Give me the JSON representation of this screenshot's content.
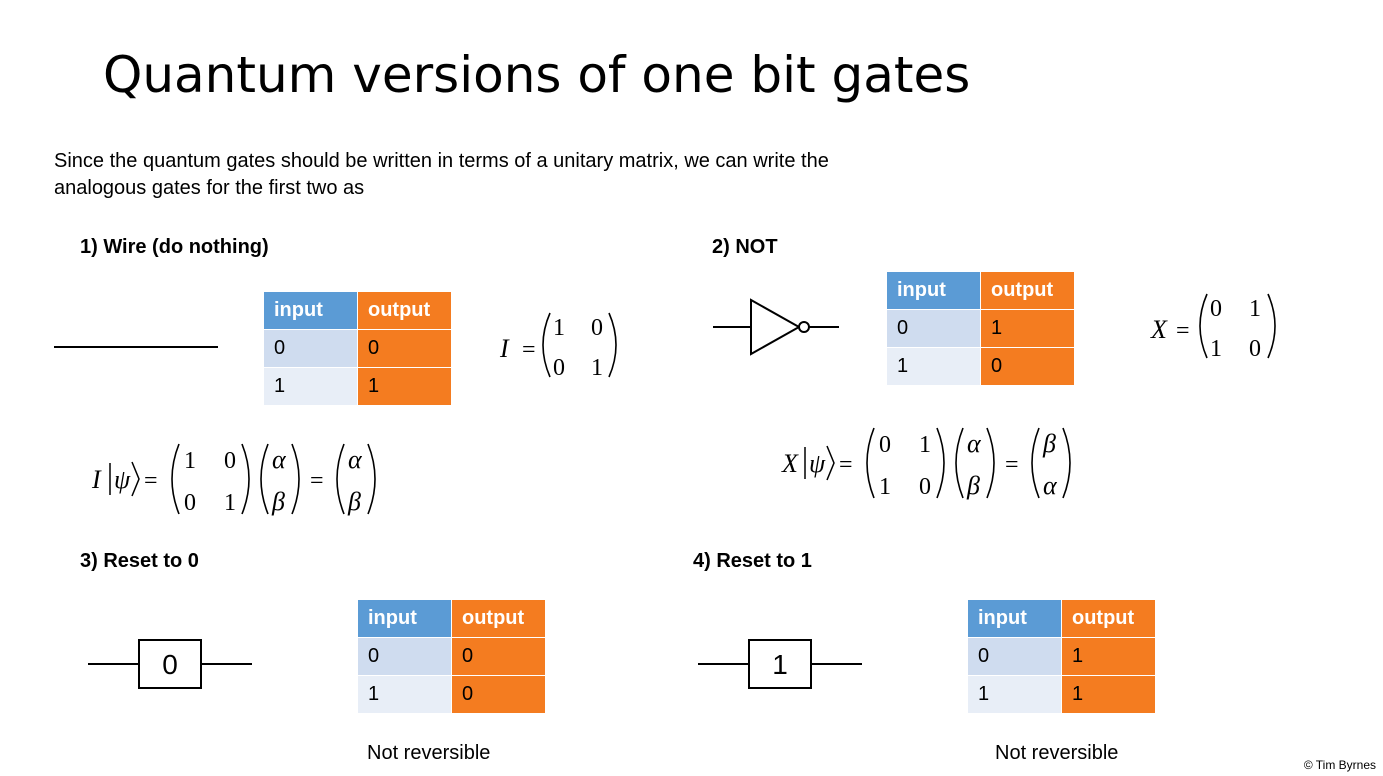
{
  "title": "Quantum versions of one bit gates",
  "intro": {
    "line1": "Since the quantum gates should be written in terms of a unitary matrix, we can write the",
    "line2": "analogous gates for the first two as"
  },
  "sections": {
    "wire": {
      "label": "1) Wire (do nothing)"
    },
    "not": {
      "label": "2) NOT"
    },
    "reset0": {
      "label": "3) Reset to 0",
      "box_label": "0",
      "note": "Not reversible"
    },
    "reset1": {
      "label": "4) Reset to 1",
      "box_label": "1",
      "note": "Not reversible"
    }
  },
  "tables": {
    "header_input": "input",
    "header_output": "output",
    "wire": {
      "rows": [
        [
          "0",
          "0"
        ],
        [
          "1",
          "1"
        ]
      ]
    },
    "not": {
      "rows": [
        [
          "0",
          "1"
        ],
        [
          "1",
          "0"
        ]
      ]
    },
    "reset0": {
      "rows": [
        [
          "0",
          "0"
        ],
        [
          "1",
          "0"
        ]
      ]
    },
    "reset1": {
      "rows": [
        [
          "0",
          "1"
        ],
        [
          "1",
          "1"
        ]
      ]
    }
  },
  "math": {
    "I": "I",
    "X": "X",
    "psi": "ψ",
    "alpha": "α",
    "beta": "β",
    "eq": "=",
    "zero": "0",
    "one": "1"
  },
  "copyright": "© Tim Byrnes"
}
